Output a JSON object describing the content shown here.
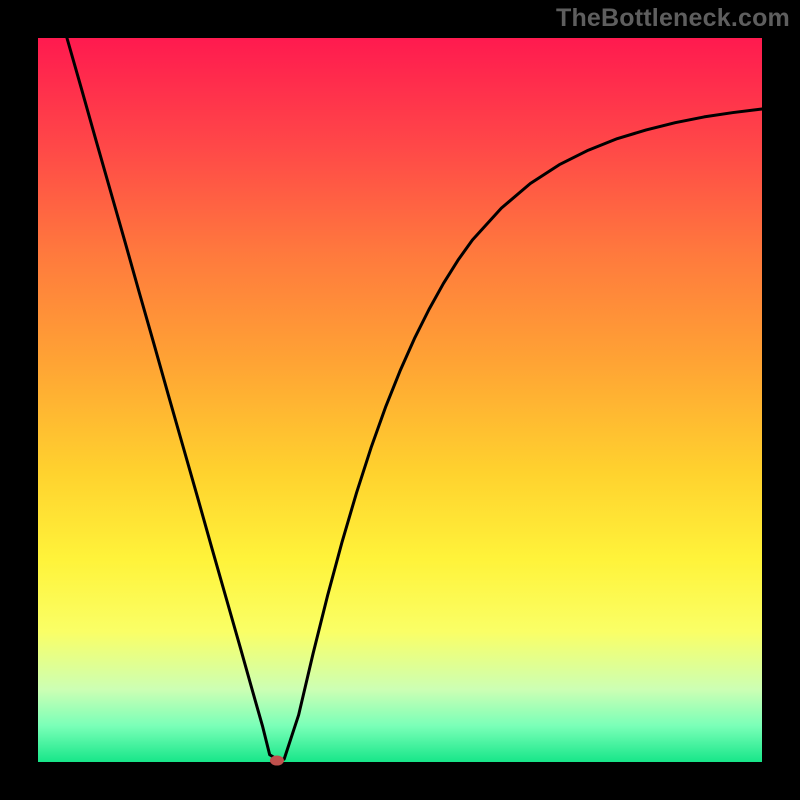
{
  "watermark": "TheBottleneck.com",
  "chart_data": {
    "type": "line",
    "title": "",
    "xlabel": "",
    "ylabel": "",
    "xlim": [
      0,
      100
    ],
    "ylim": [
      0,
      100
    ],
    "grid": false,
    "legend": null,
    "background_gradient": [
      {
        "stop": 0.0,
        "color": "#ff1a4f"
      },
      {
        "stop": 0.15,
        "color": "#ff4848"
      },
      {
        "stop": 0.3,
        "color": "#ff7a3d"
      },
      {
        "stop": 0.45,
        "color": "#ffa434"
      },
      {
        "stop": 0.6,
        "color": "#ffd22e"
      },
      {
        "stop": 0.72,
        "color": "#fff33a"
      },
      {
        "stop": 0.82,
        "color": "#faff66"
      },
      {
        "stop": 0.9,
        "color": "#ccffb4"
      },
      {
        "stop": 0.95,
        "color": "#7affb8"
      },
      {
        "stop": 1.0,
        "color": "#17e689"
      }
    ],
    "series": [
      {
        "name": "bottleneck-curve",
        "x": [
          4,
          6,
          8,
          10,
          12,
          14,
          16,
          18,
          20,
          22,
          24,
          26,
          28,
          30,
          31,
          32,
          33,
          34,
          36,
          38,
          40,
          42,
          44,
          46,
          48,
          50,
          52,
          54,
          56,
          58,
          60,
          64,
          68,
          72,
          76,
          80,
          84,
          88,
          92,
          96,
          100
        ],
        "values": [
          100,
          93.0,
          85.9,
          78.9,
          71.9,
          64.8,
          57.8,
          50.7,
          43.7,
          36.7,
          29.6,
          22.6,
          15.6,
          8.5,
          5.0,
          1.0,
          0.4,
          0.4,
          6.5,
          15.0,
          23.0,
          30.4,
          37.2,
          43.4,
          49.0,
          54.0,
          58.5,
          62.5,
          66.1,
          69.3,
          72.1,
          76.5,
          79.9,
          82.5,
          84.5,
          86.1,
          87.3,
          88.3,
          89.1,
          89.7,
          90.2
        ]
      }
    ],
    "marker": {
      "x": 33,
      "y": 0.2,
      "color": "#c0504d",
      "rx": 7,
      "ry": 5
    },
    "frame_stroke": "#000000",
    "frame_stroke_width": 38,
    "curve_stroke": "#000000",
    "curve_stroke_width": 3
  }
}
